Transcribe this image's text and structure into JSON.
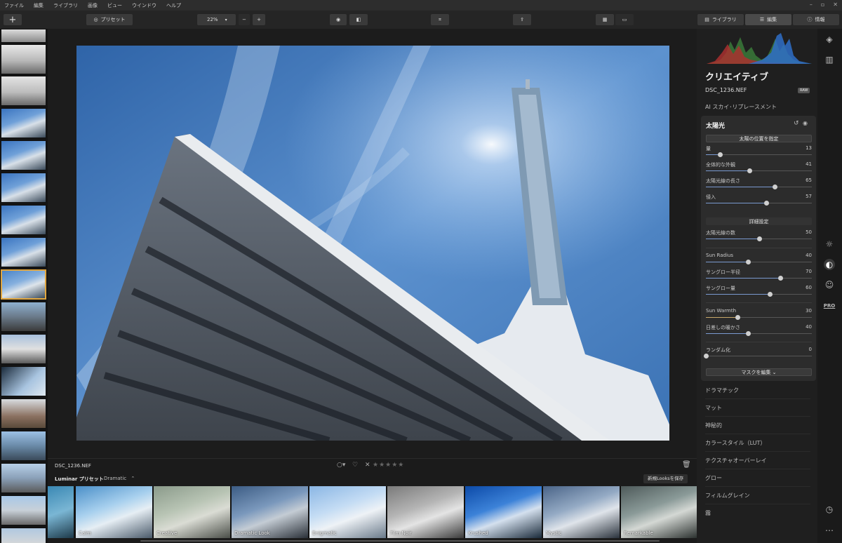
{
  "menu": [
    "ファイル",
    "編集",
    "ライブラリ",
    "画像",
    "ビュー",
    "ウインドウ",
    "ヘルプ"
  ],
  "toolbar": {
    "add_label": "+",
    "preset_label": "プリセット",
    "zoom": "22%",
    "zoom_minus": "−",
    "zoom_plus": "+",
    "library_tab": "ライブラリ",
    "edit_tab": "編集",
    "info_tab": "情報"
  },
  "panel": {
    "title": "クリエイティブ",
    "filename": "DSC_1236.NEF",
    "raw_badge": "RAW",
    "ai_sky": "AI スカイ･リプレースメント",
    "sunrays": {
      "title": "太陽光",
      "place_sun_button": "太陽の位置を指定",
      "sliders": [
        {
          "label": "量",
          "value": 13
        },
        {
          "label": "全体的な外観",
          "value": 41
        },
        {
          "label": "太陽光線の長さ",
          "value": 65
        },
        {
          "label": "侵入",
          "value": 57
        }
      ],
      "advanced_button": "詳細設定",
      "advanced_sliders": [
        {
          "label": "太陽光線の数",
          "value": 50
        },
        {
          "label": "Sun Radius",
          "value": 40
        },
        {
          "label": "サングロー半径",
          "value": 70
        },
        {
          "label": "サングロー量",
          "value": 60
        },
        {
          "label": "Sun Warmth",
          "value": 30
        },
        {
          "label": "日差しの暖かさ",
          "value": 40
        },
        {
          "label": "ランダム化",
          "value": 0
        }
      ],
      "mask_button": "マスクを編集 ⌄"
    },
    "sections": [
      "ドラマチック",
      "マット",
      "神秘的",
      "カラースタイル（LUT）",
      "テクスチャオーバーレイ",
      "グロー",
      "フィルムグレイン",
      "霧"
    ]
  },
  "infobar": {
    "filename": "DSC_1236.NEF",
    "rating_stars": "★★★★★"
  },
  "presetbar": {
    "title": "Luminar プリセット",
    "category": "Dramatic",
    "save_button": "新規Looksを保存"
  },
  "presets": [
    "",
    "Calm",
    "Creative",
    "Dramatic Look",
    "Enigmatic",
    "Film Noir",
    "Krushed",
    "Mystic",
    "Remarkable"
  ],
  "colors": {
    "accent": "#e0a640",
    "slider_fill": "#7a9ad0",
    "warm_fill": "#c8a86a"
  }
}
